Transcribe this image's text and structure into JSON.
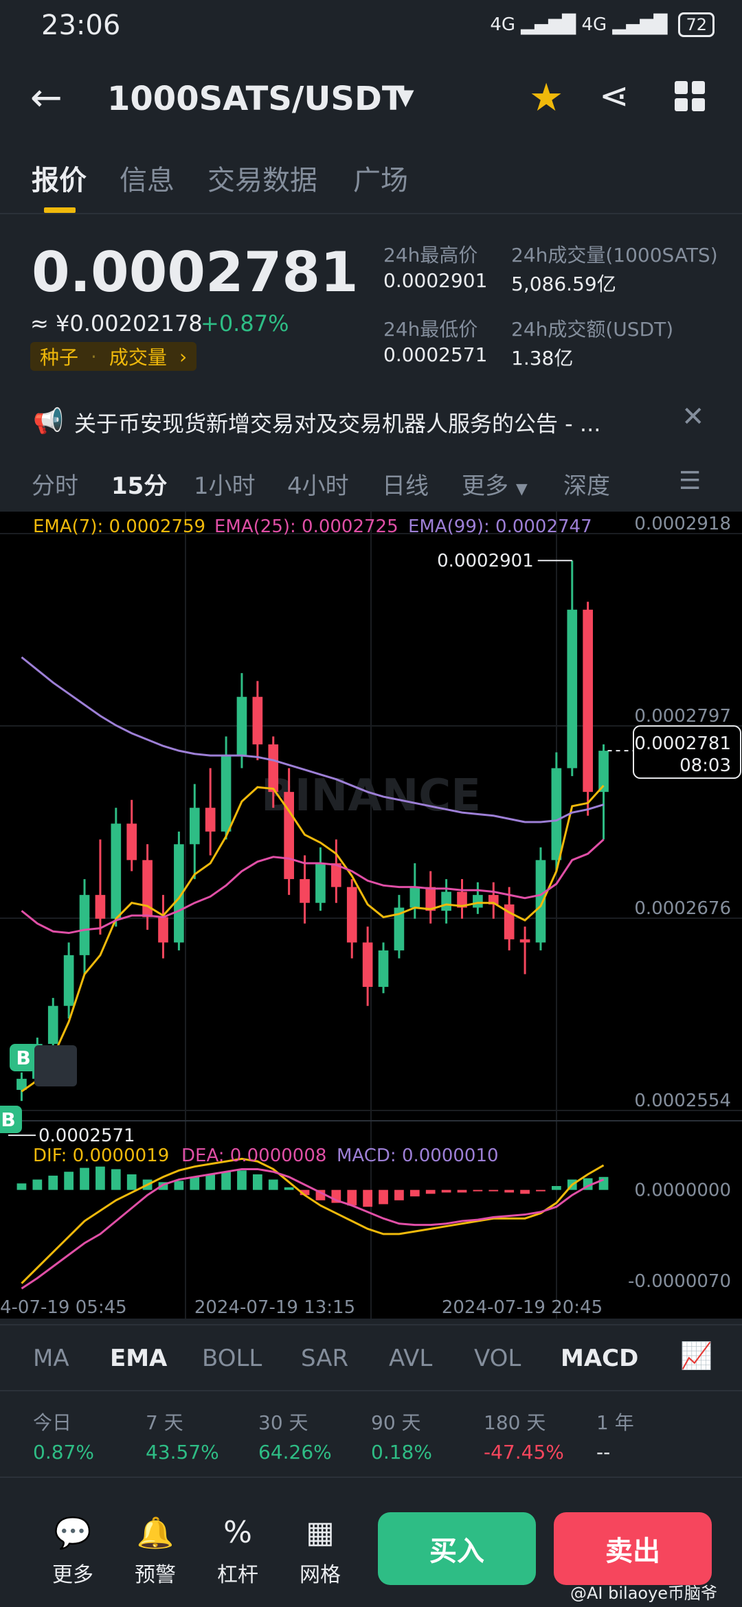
{
  "status": {
    "time": "23:06",
    "signal": "4G ▂▄▆█ 4G ▂▄▆█",
    "battery": "72"
  },
  "header": {
    "pair": "1000SATS/USDT"
  },
  "tabs": [
    "报价",
    "信息",
    "交易数据",
    "广场"
  ],
  "price": {
    "last": "0.0002781",
    "cny": "≈ ¥0.00202178",
    "change": "+0.87%",
    "tag1": "种子",
    "tag2": "成交量",
    "high_label": "24h最高价",
    "high": "0.0002901",
    "low_label": "24h最低价",
    "low": "0.0002571",
    "vol_label": "24h成交量(1000SATS)",
    "vol": "5,086.59亿",
    "amt_label": "24h成交额(USDT)",
    "amt": "1.38亿"
  },
  "announcement": "关于币安现货新增交易对及交易机器人服务的公告 - ...",
  "intervals": [
    "分时",
    "15分",
    "1小时",
    "4小时",
    "日线",
    "更多",
    "深度"
  ],
  "ema_legend": {
    "ema7": "EMA(7): 0.0002759",
    "ema25": "EMA(25): 0.0002725",
    "ema99": "EMA(99): 0.0002747"
  },
  "macd_legend": {
    "dif": "DIF: 0.0000019",
    "dea": "DEA: 0.0000008",
    "macd": "MACD: 0.0000010"
  },
  "chart": {
    "y_ticks": [
      "0.0002918",
      "0.0002797",
      "0.0002676",
      "0.0002554"
    ],
    "high_marker": "0.0002901",
    "low_marker": "0.0002571",
    "current_price": "0.0002781",
    "countdown": "08:03",
    "watermark": "BINANCE",
    "macd_ticks": [
      "0.0000000",
      "-0.0000070"
    ],
    "x_ticks": [
      "4-07-19 05:45",
      "2024-07-19 13:15",
      "2024-07-19 20:45"
    ],
    "buy_marker": "B"
  },
  "indicators": [
    "MA",
    "EMA",
    "BOLL",
    "SAR",
    "AVL",
    "VOL",
    "MACD"
  ],
  "performance": [
    {
      "label": "今日",
      "value": "0.87%"
    },
    {
      "label": "7 天",
      "value": "43.57%"
    },
    {
      "label": "30 天",
      "value": "64.26%"
    },
    {
      "label": "90 天",
      "value": "0.18%"
    },
    {
      "label": "180 天",
      "value": "-47.45%"
    },
    {
      "label": "1 年",
      "value": "--"
    }
  ],
  "nav": [
    "更多",
    "预警",
    "杠杆",
    "网格"
  ],
  "buttons": {
    "buy": "买入",
    "sell": "卖出"
  },
  "watermark": "@AI bilaoye币脑爷",
  "colors": {
    "up": "#2ebd85",
    "down": "#f6465d",
    "accent": "#f0b90b",
    "ema7": "#f0b90b",
    "ema25": "#e04fa6",
    "ema99": "#9d7fd6"
  },
  "chart_data": {
    "type": "candlestick",
    "interval": "15分",
    "ylim": [
      0.0002554,
      0.0002918
    ],
    "x_ticks": [
      "4-07-19 05:45",
      "2024-07-19 13:15",
      "2024-07-19 20:45"
    ],
    "candles": [
      {
        "o": 0.0002567,
        "h": 0.0002578,
        "l": 0.000256,
        "c": 0.0002574
      },
      {
        "o": 0.0002574,
        "h": 0.00026,
        "l": 0.0002571,
        "c": 0.0002596
      },
      {
        "o": 0.0002596,
        "h": 0.0002625,
        "l": 0.000259,
        "c": 0.000262
      },
      {
        "o": 0.000262,
        "h": 0.000266,
        "l": 0.0002612,
        "c": 0.0002652
      },
      {
        "o": 0.0002652,
        "h": 0.00027,
        "l": 0.000264,
        "c": 0.000269
      },
      {
        "o": 0.000269,
        "h": 0.0002725,
        "l": 0.0002665,
        "c": 0.0002675
      },
      {
        "o": 0.0002675,
        "h": 0.0002745,
        "l": 0.000267,
        "c": 0.0002735
      },
      {
        "o": 0.0002735,
        "h": 0.000275,
        "l": 0.0002705,
        "c": 0.0002712
      },
      {
        "o": 0.0002712,
        "h": 0.0002722,
        "l": 0.0002668,
        "c": 0.0002676
      },
      {
        "o": 0.0002676,
        "h": 0.000269,
        "l": 0.000265,
        "c": 0.000266
      },
      {
        "o": 0.000266,
        "h": 0.000273,
        "l": 0.0002655,
        "c": 0.0002722
      },
      {
        "o": 0.0002722,
        "h": 0.000276,
        "l": 0.00027,
        "c": 0.0002745
      },
      {
        "o": 0.0002745,
        "h": 0.000277,
        "l": 0.0002715,
        "c": 0.000273
      },
      {
        "o": 0.000273,
        "h": 0.000279,
        "l": 0.0002725,
        "c": 0.0002778
      },
      {
        "o": 0.0002778,
        "h": 0.000283,
        "l": 0.000277,
        "c": 0.0002815
      },
      {
        "o": 0.0002815,
        "h": 0.0002825,
        "l": 0.0002775,
        "c": 0.0002785
      },
      {
        "o": 0.0002785,
        "h": 0.000279,
        "l": 0.0002745,
        "c": 0.0002755
      },
      {
        "o": 0.0002755,
        "h": 0.000277,
        "l": 0.000269,
        "c": 0.00027
      },
      {
        "o": 0.00027,
        "h": 0.0002715,
        "l": 0.0002672,
        "c": 0.0002685
      },
      {
        "o": 0.0002685,
        "h": 0.000272,
        "l": 0.000268,
        "c": 0.000271
      },
      {
        "o": 0.000271,
        "h": 0.0002725,
        "l": 0.0002685,
        "c": 0.0002695
      },
      {
        "o": 0.0002695,
        "h": 0.00027,
        "l": 0.000265,
        "c": 0.000266
      },
      {
        "o": 0.000266,
        "h": 0.000267,
        "l": 0.000262,
        "c": 0.0002632
      },
      {
        "o": 0.0002632,
        "h": 0.000266,
        "l": 0.0002628,
        "c": 0.0002655
      },
      {
        "o": 0.0002655,
        "h": 0.000269,
        "l": 0.000265,
        "c": 0.0002682
      },
      {
        "o": 0.0002682,
        "h": 0.000271,
        "l": 0.0002675,
        "c": 0.0002695
      },
      {
        "o": 0.0002695,
        "h": 0.0002705,
        "l": 0.0002672,
        "c": 0.000268
      },
      {
        "o": 0.000268,
        "h": 0.00027,
        "l": 0.0002672,
        "c": 0.0002692
      },
      {
        "o": 0.0002692,
        "h": 0.00027,
        "l": 0.0002675,
        "c": 0.0002682
      },
      {
        "o": 0.0002682,
        "h": 0.0002698,
        "l": 0.0002678,
        "c": 0.000269
      },
      {
        "o": 0.000269,
        "h": 0.0002698,
        "l": 0.0002675,
        "c": 0.0002684
      },
      {
        "o": 0.0002684,
        "h": 0.0002695,
        "l": 0.0002655,
        "c": 0.0002662
      },
      {
        "o": 0.0002662,
        "h": 0.000267,
        "l": 0.000264,
        "c": 0.000266
      },
      {
        "o": 0.000266,
        "h": 0.000272,
        "l": 0.0002655,
        "c": 0.0002712
      },
      {
        "o": 0.0002712,
        "h": 0.000278,
        "l": 0.0002705,
        "c": 0.000277
      },
      {
        "o": 0.000277,
        "h": 0.0002901,
        "l": 0.0002765,
        "c": 0.000287
      },
      {
        "o": 0.000287,
        "h": 0.0002875,
        "l": 0.000274,
        "c": 0.0002755
      },
      {
        "o": 0.0002755,
        "h": 0.0002785,
        "l": 0.0002725,
        "c": 0.0002781
      }
    ],
    "series": [
      {
        "name": "EMA(7)",
        "color": "#f0b90b",
        "values": [
          0.0002566,
          0.0002573,
          0.0002588,
          0.000261,
          0.000264,
          0.0002652,
          0.0002675,
          0.0002685,
          0.0002683,
          0.0002677,
          0.0002688,
          0.0002703,
          0.000271,
          0.0002727,
          0.0002749,
          0.0002758,
          0.0002757,
          0.0002743,
          0.0002728,
          0.0002723,
          0.0002716,
          0.0002702,
          0.0002684,
          0.0002676,
          0.0002678,
          0.0002682,
          0.0002681,
          0.0002684,
          0.0002683,
          0.0002685,
          0.0002685,
          0.0002679,
          0.0002674,
          0.0002683,
          0.0002705,
          0.0002746,
          0.0002748,
          0.0002759
        ]
      },
      {
        "name": "EMA(25)",
        "color": "#e04fa6",
        "values": [
          0.000268,
          0.0002672,
          0.0002667,
          0.0002666,
          0.0002668,
          0.0002669,
          0.0002674,
          0.0002677,
          0.0002677,
          0.0002676,
          0.000268,
          0.0002685,
          0.0002689,
          0.0002696,
          0.0002705,
          0.0002711,
          0.0002714,
          0.0002713,
          0.000271,
          0.000271,
          0.0002709,
          0.0002705,
          0.0002699,
          0.0002696,
          0.0002695,
          0.0002695,
          0.0002694,
          0.0002694,
          0.0002693,
          0.0002693,
          0.0002692,
          0.000269,
          0.0002688,
          0.000269,
          0.0002697,
          0.0002712,
          0.0002716,
          0.0002725
        ]
      },
      {
        "name": "EMA(99)",
        "color": "#9d7fd6",
        "values": [
          0.000284,
          0.0002832,
          0.0002824,
          0.0002817,
          0.000281,
          0.0002803,
          0.0002797,
          0.0002792,
          0.0002788,
          0.0002784,
          0.0002781,
          0.0002779,
          0.0002778,
          0.0002778,
          0.0002778,
          0.0002777,
          0.0002775,
          0.0002772,
          0.0002769,
          0.0002766,
          0.0002763,
          0.0002759,
          0.0002755,
          0.0002752,
          0.000275,
          0.0002748,
          0.0002746,
          0.0002744,
          0.0002742,
          0.0002741,
          0.000274,
          0.0002738,
          0.0002736,
          0.0002736,
          0.0002737,
          0.0002742,
          0.0002744,
          0.0002747
        ]
      }
    ],
    "macd": {
      "ylim": [
        -7.8e-06,
        3e-06
      ],
      "hist": [
        5e-07,
        8e-07,
        1.1e-06,
        1.4e-06,
        1.7e-06,
        1.8e-06,
        1.6e-06,
        1.2e-06,
        8e-07,
        6e-07,
        7e-07,
        1e-06,
        1.2e-06,
        1.4e-06,
        1.5e-06,
        1.2e-06,
        8e-07,
        2e-07,
        -4e-07,
        -8e-07,
        -1e-06,
        -1.2e-06,
        -1.3e-06,
        -1.1e-06,
        -8e-07,
        -5e-07,
        -3e-07,
        -2e-07,
        -2e-07,
        -1e-07,
        -1e-07,
        -2e-07,
        -3e-07,
        -1e-07,
        3e-07,
        8e-07,
        9e-07,
        1e-06
      ],
      "dif": [
        -7.2e-06,
        -6e-06,
        -4.8e-06,
        -3.6e-06,
        -2.4e-06,
        -1.6e-06,
        -8e-07,
        -2e-07,
        4e-07,
        1e-06,
        1.5e-06,
        1.8e-06,
        2e-06,
        2.2e-06,
        2.4e-06,
        2.2e-06,
        1.6e-06,
        6e-07,
        -4e-07,
        -1.2e-06,
        -1.8e-06,
        -2.4e-06,
        -3e-06,
        -3.4e-06,
        -3.4e-06,
        -3.2e-06,
        -3e-06,
        -2.8e-06,
        -2.6e-06,
        -2.4e-06,
        -2.2e-06,
        -2.2e-06,
        -2.2e-06,
        -1.8e-06,
        -1e-06,
        4e-07,
        1.2e-06,
        1.9e-06
      ],
      "dea": [
        -7.6e-06,
        -6.8e-06,
        -5.9e-06,
        -5e-06,
        -4.1e-06,
        -3.4e-06,
        -2.4e-06,
        -1.4e-06,
        -4e-07,
        4e-07,
        8e-07,
        1e-06,
        1.2e-06,
        1.4e-06,
        1.6e-06,
        1.6e-06,
        1.4e-06,
        1e-06,
        4e-07,
        -2e-07,
        -8e-07,
        -1.2e-06,
        -1.7e-06,
        -2.2e-06,
        -2.6e-06,
        -2.7e-06,
        -2.7e-06,
        -2.6e-06,
        -2.4e-06,
        -2.3e-06,
        -2.1e-06,
        -2e-06,
        -1.9e-06,
        -1.7e-06,
        -1.3e-06,
        -4e-07,
        3e-07,
        8e-07
      ]
    }
  }
}
